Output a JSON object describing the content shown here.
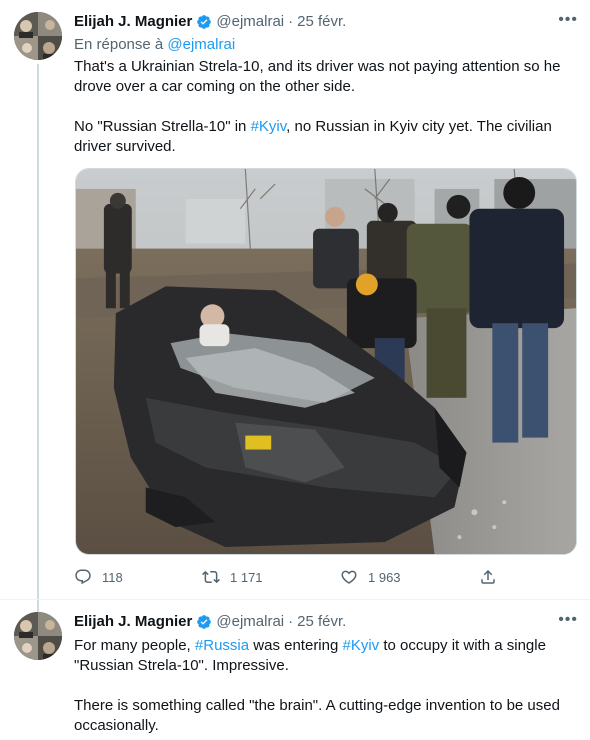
{
  "tweet1": {
    "author_name": "Elijah J. Magnier",
    "handle": "@ejmalrai",
    "separator": "·",
    "date": "25 févr.",
    "more_label": "•••",
    "reply_prefix": "En réponse à",
    "reply_handle": "@ejmalrai",
    "para1": "That's a Ukrainian Strela-10, and its driver was not paying attention so he drove over a car coming on the other side.",
    "para2_a": "No \"Russian Strella-10\" in ",
    "para2_link": "#Kyiv",
    "para2_b": ", no Russian in Kyiv city yet. The civilian driver survived.",
    "actions": {
      "reply_count": "118",
      "retweet_count": "1 171",
      "like_count": "1 963"
    }
  },
  "tweet2": {
    "author_name": "Elijah J. Magnier",
    "handle": "@ejmalrai",
    "separator": "·",
    "date": "25 févr.",
    "more_label": "•••",
    "line1_a": "For many people, ",
    "line1_link1": "#Russia",
    "line1_b": " was entering ",
    "line1_link2": "#Kyiv",
    "line1_c": " to occupy it with a single \"Russian Strela-10\". Impressive.",
    "para2": "There is something called \"the brain\". A cutting-edge invention to be used occasionally."
  },
  "colors": {
    "accent": "#1d9bf0",
    "text": "#0f1419",
    "muted": "#536471",
    "divider": "#eff3f4"
  },
  "icons": [
    "verified-badge-icon",
    "more-icon",
    "reply-icon",
    "retweet-icon",
    "like-icon",
    "share-icon"
  ]
}
